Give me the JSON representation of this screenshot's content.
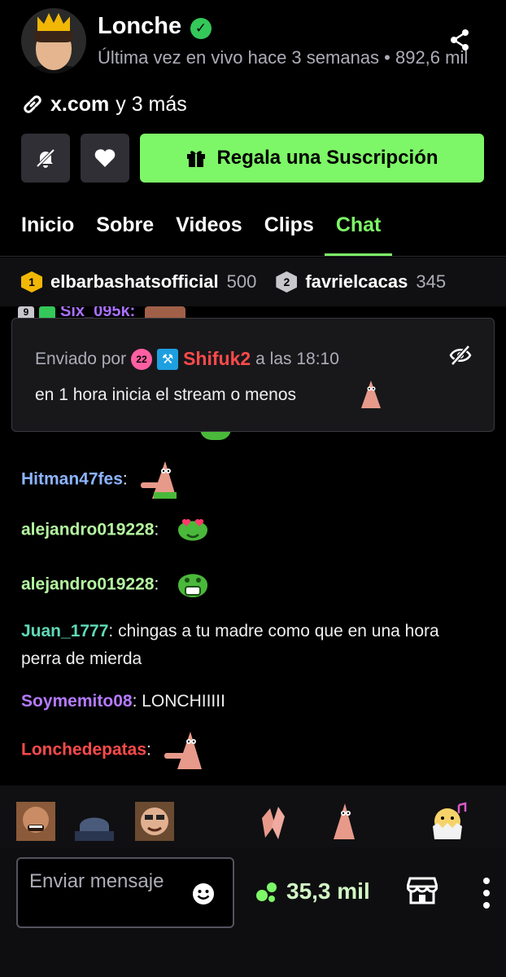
{
  "channel": {
    "name": "Lonche",
    "last_live": "Última vez en vivo hace 3 semanas • 892,6 mil",
    "links_main": "x.com",
    "links_more": "y 3 más",
    "accent_color": "#7df767"
  },
  "actions": {
    "gift_label": "Regala una Suscripción"
  },
  "tabs": [
    {
      "label": "Inicio"
    },
    {
      "label": "Sobre"
    },
    {
      "label": "Videos"
    },
    {
      "label": "Clips"
    },
    {
      "label": "Chat",
      "active": true
    }
  ],
  "leaderboard": [
    {
      "rank": "1",
      "user": "elbarbashatsofficial",
      "score": "500"
    },
    {
      "rank": "2",
      "user": "favrielcacas",
      "score": "345"
    }
  ],
  "chat": {
    "partial": {
      "badge": "9",
      "user": "Six_095k:"
    },
    "pinned": {
      "sent_by": "Enviado por",
      "sub_badge": "22",
      "user": "Shifuk2",
      "at_time": "a las 18:10",
      "text": "en 1 hora inicia el stream o menos"
    },
    "messages": [
      {
        "user": "Hitman47fes",
        "sep": ":",
        "text": "",
        "user_color": "#8cb4ff",
        "emote": "patrick"
      },
      {
        "user": "alejandro019228",
        "sep": ":",
        "text": "",
        "user_color": "#b4f5a0",
        "emote": "green-heart-eyes"
      },
      {
        "user": "alejandro019228",
        "sep": ":",
        "text": "",
        "user_color": "#b4f5a0",
        "emote": "green-crying"
      },
      {
        "user": "Juan_1777",
        "sep": ":",
        "text": " chingas a tu madre como que en una hora perra de mierda",
        "user_color": "#5fd9b6"
      },
      {
        "user": "Soymemito08",
        "sep": ":",
        "text": " LONCHIIIII",
        "user_color": "#b57aff"
      },
      {
        "user": "Lonchedepatas",
        "sep": ":",
        "text": "",
        "user_color": "#ff4a4a",
        "emote": "patrick"
      }
    ]
  },
  "input": {
    "placeholder": "Enviar mensaje"
  },
  "points": {
    "value": "35,3 mil"
  }
}
